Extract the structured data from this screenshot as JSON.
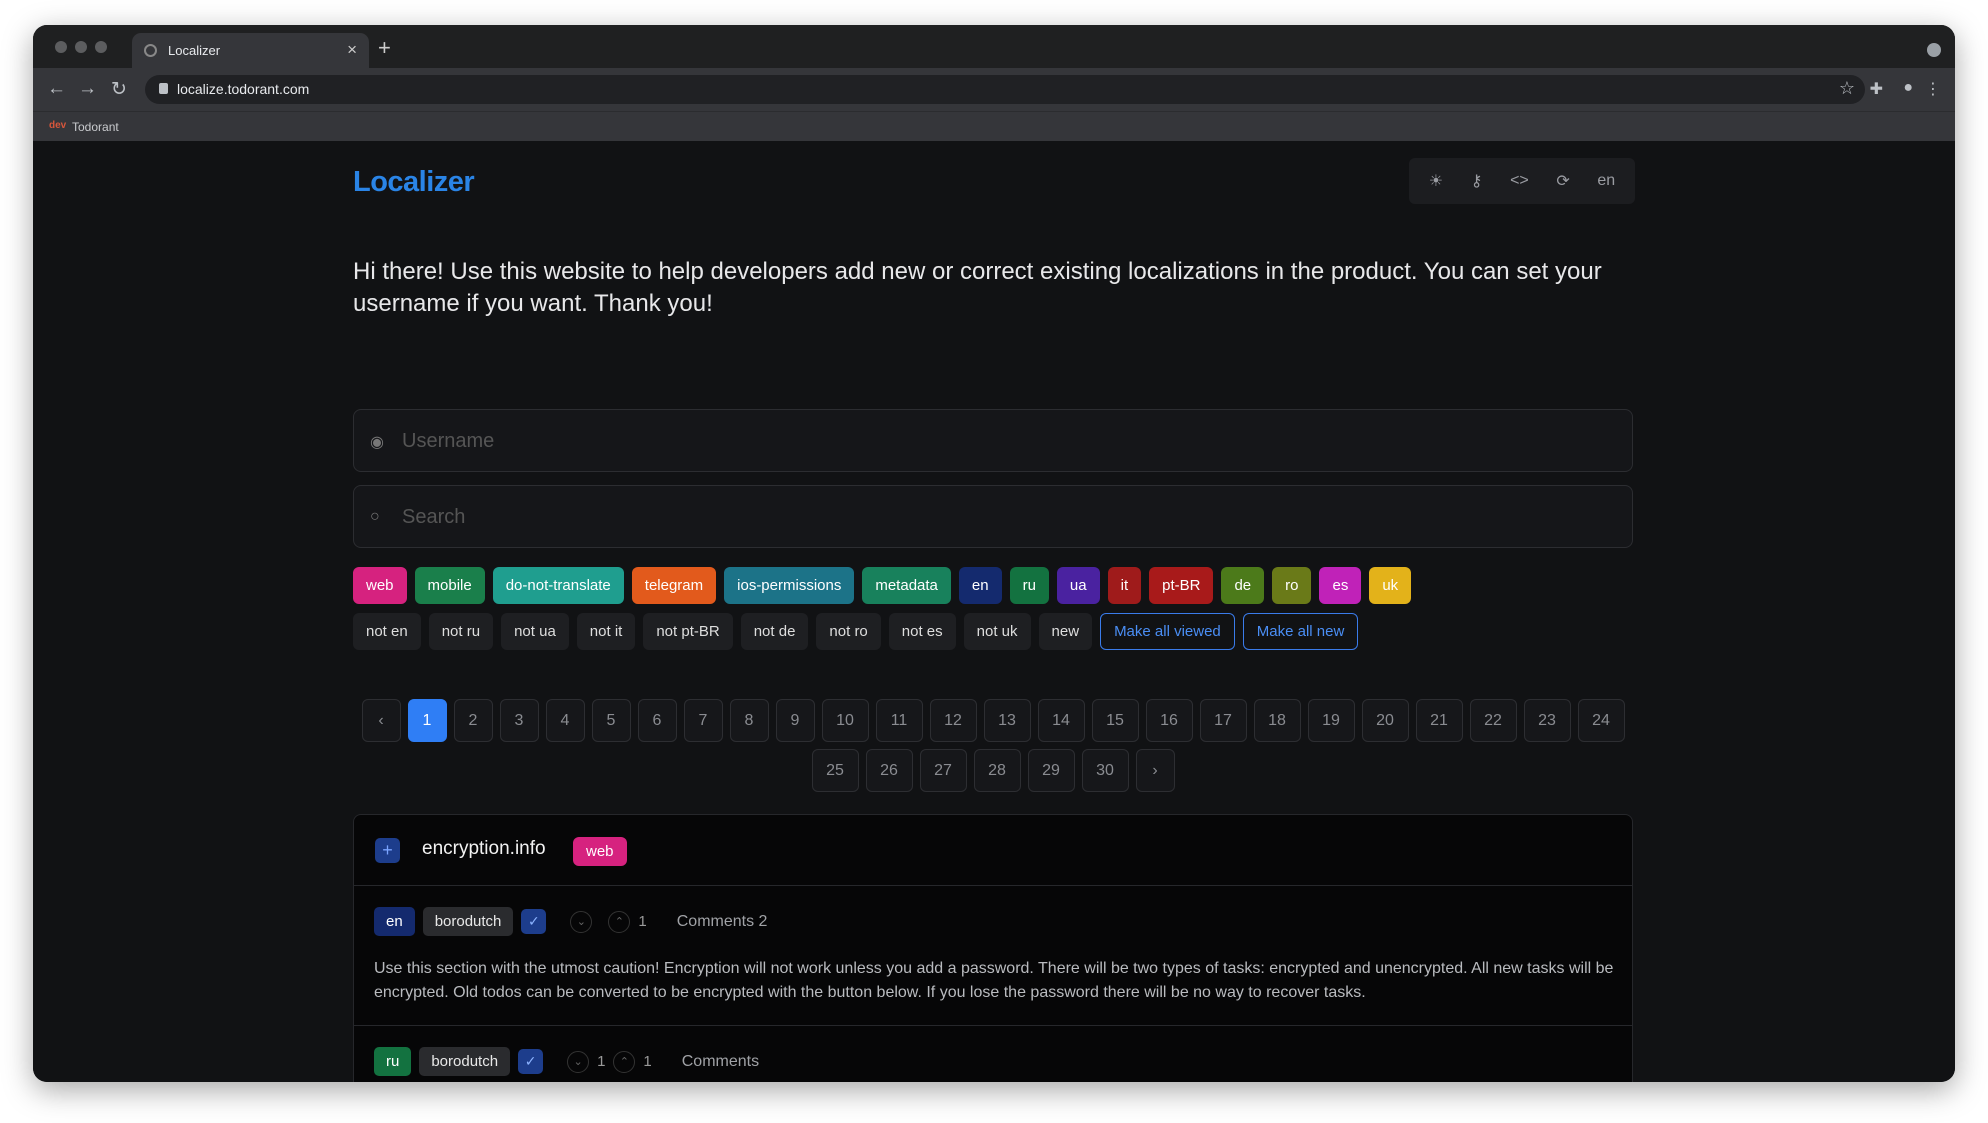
{
  "browser": {
    "tab_title": "Localizer",
    "tab_close": "×",
    "new_tab": "+",
    "url": "localize.todorant.com",
    "bookmark_icon": "dev",
    "bookmark": "Todorant"
  },
  "header": {
    "logo": "Localizer",
    "tools": [
      "sun-icon",
      "key-icon",
      "code-icon",
      "refresh-icon"
    ],
    "lang": "en"
  },
  "intro": "Hi there! Use this website to help developers add new or correct existing localizations in the product. You can set your username if you want. Thank you!",
  "username": {
    "placeholder": "Username"
  },
  "search": {
    "placeholder": "Search"
  },
  "tags": [
    {
      "label": "web",
      "color": "#d6227f"
    },
    {
      "label": "mobile",
      "color": "#1a7f4b"
    },
    {
      "label": "do-not-translate",
      "color": "#1f9e8f"
    },
    {
      "label": "telegram",
      "color": "#e25a1c"
    },
    {
      "label": "ios-permissions",
      "color": "#1c7388"
    },
    {
      "label": "metadata",
      "color": "#18815c"
    },
    {
      "label": "en",
      "color": "#142a6e"
    },
    {
      "label": "ru",
      "color": "#137240"
    },
    {
      "label": "ua",
      "color": "#4a22a0"
    },
    {
      "label": "it",
      "color": "#9f1b1b"
    },
    {
      "label": "pt-BR",
      "color": "#a81a1a"
    },
    {
      "label": "de",
      "color": "#4c7a1a"
    },
    {
      "label": "ro",
      "color": "#6a7a18"
    },
    {
      "label": "es",
      "color": "#c022b8"
    },
    {
      "label": "uk",
      "color": "#e3b21a"
    }
  ],
  "filters": [
    "not en",
    "not ru",
    "not ua",
    "not it",
    "not pt-BR",
    "not de",
    "not ro",
    "not es",
    "not uk",
    "new"
  ],
  "actions": {
    "viewed": "Make all viewed",
    "new": "Make all new"
  },
  "pagination": {
    "prev": "‹",
    "next": "›",
    "current": "1",
    "pages": [
      "1",
      "2",
      "3",
      "4",
      "5",
      "6",
      "7",
      "8",
      "9",
      "10",
      "11",
      "12",
      "13",
      "14",
      "15",
      "16",
      "17",
      "18",
      "19",
      "20",
      "21",
      "22",
      "23",
      "24",
      "25",
      "26",
      "27",
      "28",
      "29",
      "30"
    ]
  },
  "entry": {
    "key": "encryption.info",
    "tag": "web",
    "plus": "+",
    "translations": [
      {
        "lang": "en",
        "lang_color": "#142a6e",
        "user": "borodutch",
        "down_votes": "",
        "up_votes": "1",
        "comments": "Comments 2",
        "text": "Use this section with the utmost caution! Encryption will not work unless you add a password. There will be two types of tasks: encrypted and unencrypted. All new tasks will be encrypted. Old todos can be converted to be encrypted with the button below. If you lose the password there will be no way to recover tasks."
      },
      {
        "lang": "ru",
        "lang_color": "#137240",
        "user": "borodutch",
        "down_votes": "1",
        "up_votes": "1",
        "comments": "Comments"
      }
    ]
  }
}
